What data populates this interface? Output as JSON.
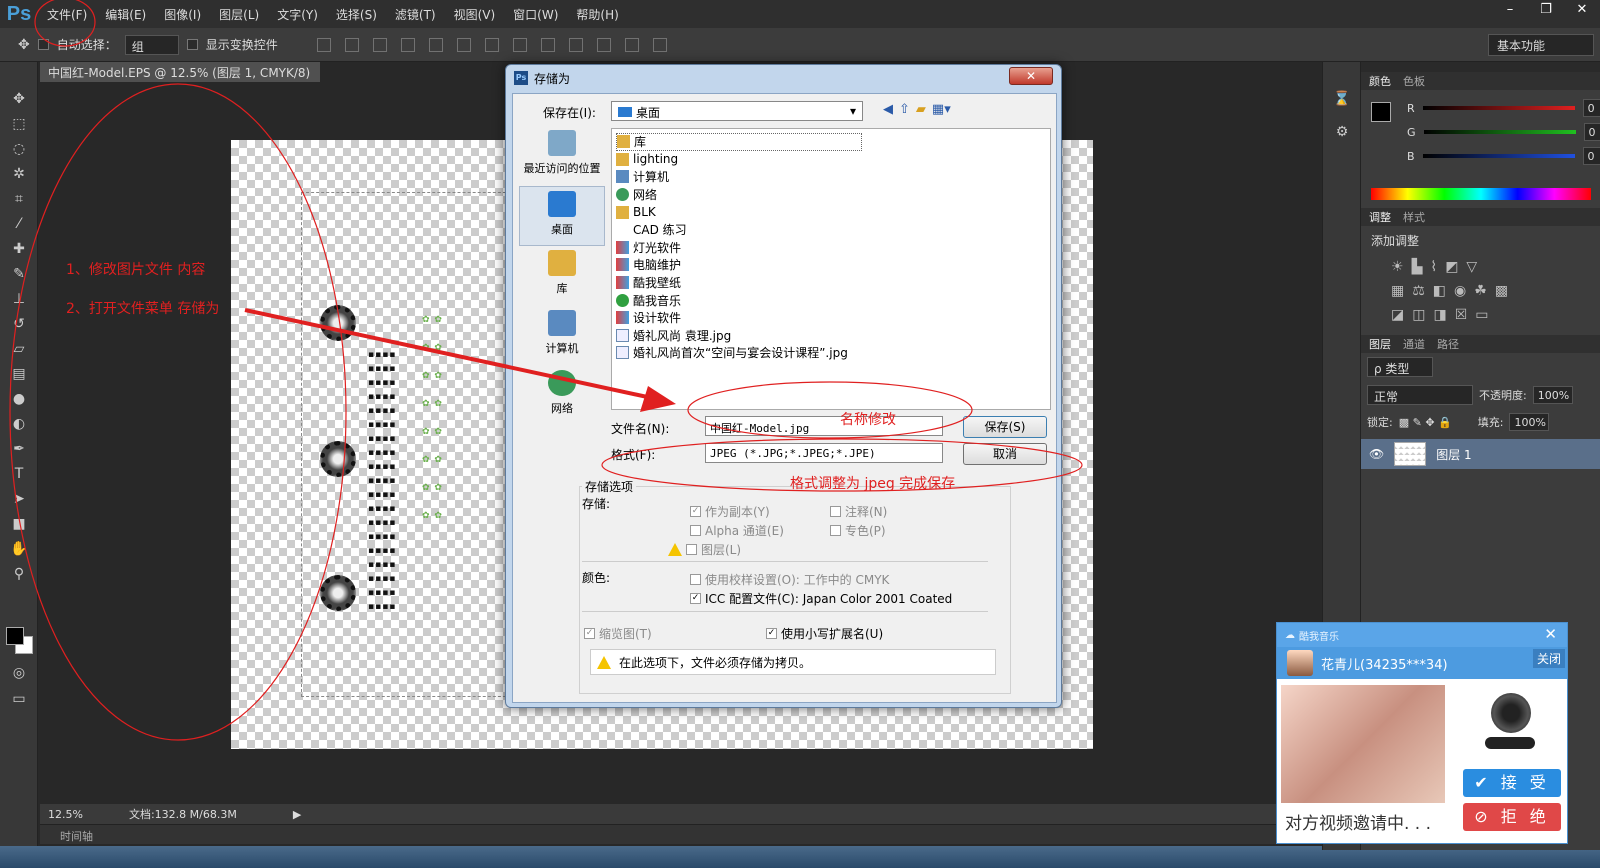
{
  "app": {
    "logo": "Ps"
  },
  "menu": [
    "文件(F)",
    "编辑(E)",
    "图像(I)",
    "图层(L)",
    "文字(Y)",
    "选择(S)",
    "滤镜(T)",
    "视图(V)",
    "窗口(W)",
    "帮助(H)"
  ],
  "window_controls": [
    "–",
    "❐",
    "✕"
  ],
  "options": {
    "auto_select": "自动选择：",
    "group": "组",
    "show_transform": "显示变换控件",
    "workspace": "基本功能"
  },
  "document": {
    "tab": "中国红-Model.EPS @ 12.5% (图层 1, CMYK/8) *",
    "zoom": "12.5%",
    "doc_info": "文档:132.8 M/68.3M",
    "timeline": "时间轴"
  },
  "panels": {
    "color_tabs": [
      "颜色",
      "色板"
    ],
    "sliders": [
      {
        "label": "R",
        "value": "0",
        "color": "#e02020"
      },
      {
        "label": "G",
        "value": "0",
        "color": "#20c020"
      },
      {
        "label": "B",
        "value": "0",
        "color": "#2050e0"
      }
    ],
    "adjust_tabs": [
      "调整",
      "样式"
    ],
    "add_adjust": "添加调整",
    "layer_tabs": [
      "图层",
      "通道",
      "路径"
    ],
    "kind": "ρ 类型",
    "blend": "正常",
    "opacity_label": "不透明度:",
    "opacity": "100%",
    "lock_label": "锁定:",
    "fill_label": "填充:",
    "fill": "100%",
    "layer_name": "图层 1"
  },
  "dialog": {
    "title": "存储为",
    "close": "✕",
    "save_in_label": "保存在(I):",
    "save_in": "桌面",
    "places": [
      "最近访问的位置",
      "桌面",
      "库",
      "计算机",
      "网络"
    ],
    "files": [
      "库",
      "lighting",
      "计算机",
      "网络",
      "BLK",
      "CAD 练习",
      "灯光软件",
      "电脑维护",
      "酷我壁纸",
      "酷我音乐",
      "设计软件",
      "婚礼风尚 袁理.jpg",
      "婚礼风尚首次“空间与宴会设计课程”.jpg"
    ],
    "filename_label": "文件名(N):",
    "filename": "中国红-Model.jpg",
    "format_label": "格式(F):",
    "format": "JPEG (*.JPG;*.JPEG;*.JPE)",
    "save_btn": "保存(S)",
    "cancel_btn": "取消",
    "options_title": "存储选项",
    "store_label": "存储:",
    "as_copy": "作为副本(Y)",
    "notes": "注释(N)",
    "alpha": "Alpha 通道(E)",
    "spot": "专色(P)",
    "layers": "图层(L)",
    "color_label": "颜色:",
    "proof": "使用校样设置(O):  工作中的 CMYK",
    "icc": "ICC 配置文件(C):  Japan Color 2001 Coated",
    "thumb": "缩览图(T)",
    "lowercase": "使用小写扩展名(U)",
    "warning": "在此选项下，文件必须存储为拷贝。"
  },
  "annotations": {
    "step1": "1、修改图片文件 内容",
    "step2": "2、打开文件菜单 存储为",
    "rename": "名称修改",
    "format_note": "格式调整为 jpeg 完成保存",
    "color": "#e02020"
  },
  "popup": {
    "app_name": "酷我音乐",
    "close": "✕",
    "user": "花青儿(34235***34)",
    "close_label": "关闭",
    "accept": "✔ 接 受",
    "reject": "⊘ 拒 绝",
    "status": "对方视频邀请中. . .",
    "accept_color": "#2a8de0",
    "reject_color": "#e04848"
  }
}
